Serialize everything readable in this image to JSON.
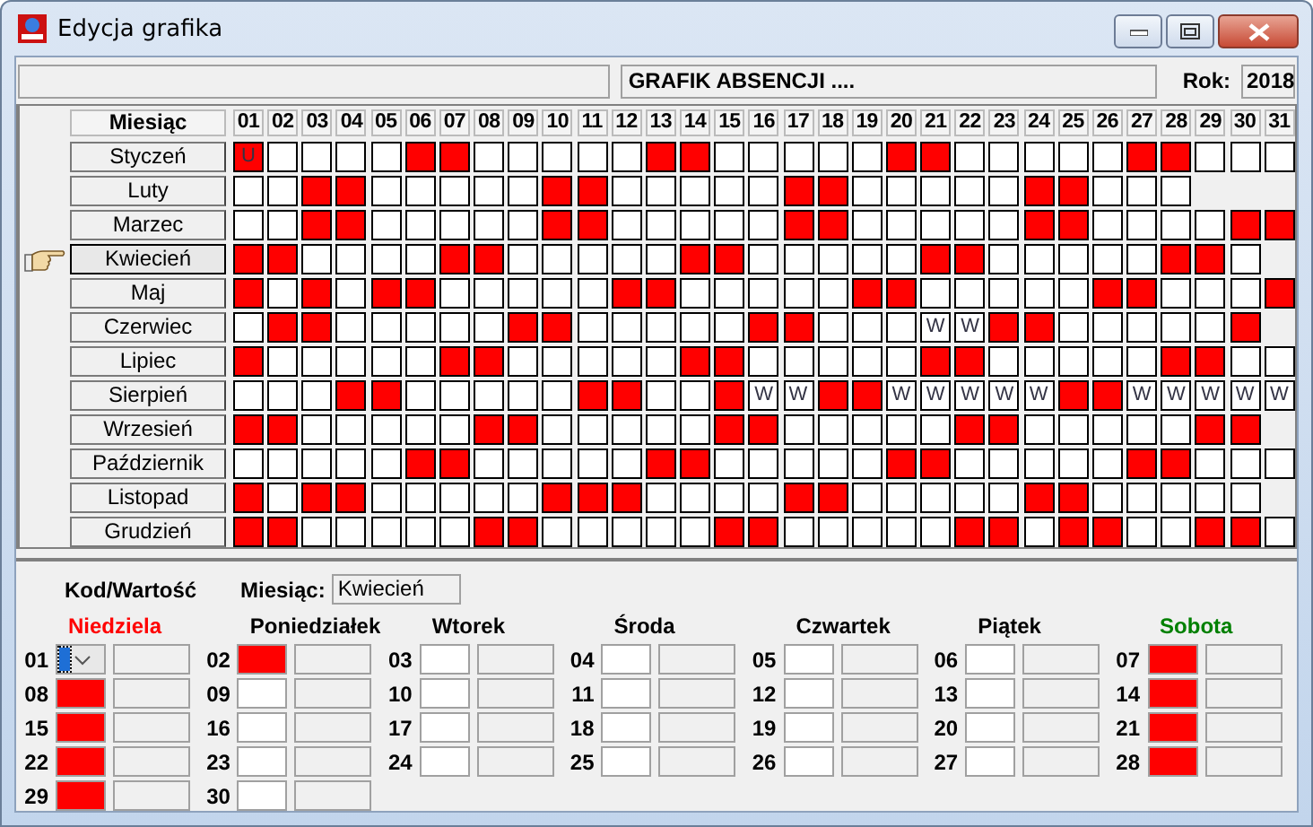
{
  "window": {
    "title": "Edycja grafika"
  },
  "header": {
    "schedule_title": "GRAFIK ABSENCJI ....",
    "year_label": "Rok:",
    "year": "2018"
  },
  "grid": {
    "month_heading": "Miesiąc",
    "day_headers": [
      "01",
      "02",
      "03",
      "04",
      "05",
      "06",
      "07",
      "08",
      "09",
      "10",
      "11",
      "12",
      "13",
      "14",
      "15",
      "16",
      "17",
      "18",
      "19",
      "20",
      "21",
      "22",
      "23",
      "24",
      "25",
      "26",
      "27",
      "28",
      "29",
      "30",
      "31"
    ],
    "months": [
      {
        "name": "Styczeń",
        "selected": false,
        "cells": [
          {
            "marked": true,
            "text": "U"
          },
          {
            "marked": false
          },
          {
            "marked": false
          },
          {
            "marked": false
          },
          {
            "marked": false
          },
          {
            "marked": true
          },
          {
            "marked": true
          },
          {
            "marked": false
          },
          {
            "marked": false
          },
          {
            "marked": false
          },
          {
            "marked": false
          },
          {
            "marked": false
          },
          {
            "marked": true
          },
          {
            "marked": true
          },
          {
            "marked": false
          },
          {
            "marked": false
          },
          {
            "marked": false
          },
          {
            "marked": false
          },
          {
            "marked": false
          },
          {
            "marked": true
          },
          {
            "marked": true
          },
          {
            "marked": false
          },
          {
            "marked": false
          },
          {
            "marked": false
          },
          {
            "marked": false
          },
          {
            "marked": false
          },
          {
            "marked": true
          },
          {
            "marked": true
          },
          {
            "marked": false
          },
          {
            "marked": false
          },
          {
            "marked": false
          }
        ]
      },
      {
        "name": "Luty",
        "selected": false,
        "cells": [
          {
            "marked": false
          },
          {
            "marked": false
          },
          {
            "marked": true
          },
          {
            "marked": true
          },
          {
            "marked": false
          },
          {
            "marked": false
          },
          {
            "marked": false
          },
          {
            "marked": false
          },
          {
            "marked": false
          },
          {
            "marked": true
          },
          {
            "marked": true
          },
          {
            "marked": false
          },
          {
            "marked": false
          },
          {
            "marked": false
          },
          {
            "marked": false
          },
          {
            "marked": false
          },
          {
            "marked": true
          },
          {
            "marked": true
          },
          {
            "marked": false
          },
          {
            "marked": false
          },
          {
            "marked": false
          },
          {
            "marked": false
          },
          {
            "marked": false
          },
          {
            "marked": true
          },
          {
            "marked": true
          },
          {
            "marked": false
          },
          {
            "marked": false
          },
          {
            "marked": false
          }
        ]
      },
      {
        "name": "Marzec",
        "selected": false,
        "cells": [
          {
            "marked": false
          },
          {
            "marked": false
          },
          {
            "marked": true
          },
          {
            "marked": true
          },
          {
            "marked": false
          },
          {
            "marked": false
          },
          {
            "marked": false
          },
          {
            "marked": false
          },
          {
            "marked": false
          },
          {
            "marked": true
          },
          {
            "marked": true
          },
          {
            "marked": false
          },
          {
            "marked": false
          },
          {
            "marked": false
          },
          {
            "marked": false
          },
          {
            "marked": false
          },
          {
            "marked": true
          },
          {
            "marked": true
          },
          {
            "marked": false
          },
          {
            "marked": false
          },
          {
            "marked": false
          },
          {
            "marked": false
          },
          {
            "marked": false
          },
          {
            "marked": true
          },
          {
            "marked": true
          },
          {
            "marked": false
          },
          {
            "marked": false
          },
          {
            "marked": false
          },
          {
            "marked": false
          },
          {
            "marked": true
          },
          {
            "marked": true
          }
        ]
      },
      {
        "name": "Kwiecień",
        "selected": true,
        "cells": [
          {
            "marked": true
          },
          {
            "marked": true
          },
          {
            "marked": false
          },
          {
            "marked": false
          },
          {
            "marked": false
          },
          {
            "marked": false
          },
          {
            "marked": true
          },
          {
            "marked": true
          },
          {
            "marked": false
          },
          {
            "marked": false
          },
          {
            "marked": false
          },
          {
            "marked": false
          },
          {
            "marked": false
          },
          {
            "marked": true
          },
          {
            "marked": true
          },
          {
            "marked": false
          },
          {
            "marked": false
          },
          {
            "marked": false
          },
          {
            "marked": false
          },
          {
            "marked": false
          },
          {
            "marked": true
          },
          {
            "marked": true
          },
          {
            "marked": false
          },
          {
            "marked": false
          },
          {
            "marked": false
          },
          {
            "marked": false
          },
          {
            "marked": false
          },
          {
            "marked": true
          },
          {
            "marked": true
          },
          {
            "marked": false
          }
        ]
      },
      {
        "name": "Maj",
        "selected": false,
        "cells": [
          {
            "marked": true
          },
          {
            "marked": false
          },
          {
            "marked": true
          },
          {
            "marked": false
          },
          {
            "marked": true
          },
          {
            "marked": true
          },
          {
            "marked": false
          },
          {
            "marked": false
          },
          {
            "marked": false
          },
          {
            "marked": false
          },
          {
            "marked": false
          },
          {
            "marked": true
          },
          {
            "marked": true
          },
          {
            "marked": false
          },
          {
            "marked": false
          },
          {
            "marked": false
          },
          {
            "marked": false
          },
          {
            "marked": false
          },
          {
            "marked": true
          },
          {
            "marked": true
          },
          {
            "marked": false
          },
          {
            "marked": false
          },
          {
            "marked": false
          },
          {
            "marked": false
          },
          {
            "marked": false
          },
          {
            "marked": true
          },
          {
            "marked": true
          },
          {
            "marked": false
          },
          {
            "marked": false
          },
          {
            "marked": false
          },
          {
            "marked": true
          }
        ]
      },
      {
        "name": "Czerwiec",
        "selected": false,
        "cells": [
          {
            "marked": false
          },
          {
            "marked": true
          },
          {
            "marked": true
          },
          {
            "marked": false
          },
          {
            "marked": false
          },
          {
            "marked": false
          },
          {
            "marked": false
          },
          {
            "marked": false
          },
          {
            "marked": true
          },
          {
            "marked": true
          },
          {
            "marked": false
          },
          {
            "marked": false
          },
          {
            "marked": false
          },
          {
            "marked": false
          },
          {
            "marked": false
          },
          {
            "marked": true
          },
          {
            "marked": true
          },
          {
            "marked": false
          },
          {
            "marked": false
          },
          {
            "marked": false
          },
          {
            "marked": false,
            "text": "W"
          },
          {
            "marked": false,
            "text": "W"
          },
          {
            "marked": true
          },
          {
            "marked": true
          },
          {
            "marked": false
          },
          {
            "marked": false
          },
          {
            "marked": false
          },
          {
            "marked": false
          },
          {
            "marked": false
          },
          {
            "marked": true
          }
        ]
      },
      {
        "name": "Lipiec",
        "selected": false,
        "cells": [
          {
            "marked": true
          },
          {
            "marked": false
          },
          {
            "marked": false
          },
          {
            "marked": false
          },
          {
            "marked": false
          },
          {
            "marked": false
          },
          {
            "marked": true
          },
          {
            "marked": true
          },
          {
            "marked": false
          },
          {
            "marked": false
          },
          {
            "marked": false
          },
          {
            "marked": false
          },
          {
            "marked": false
          },
          {
            "marked": true
          },
          {
            "marked": true
          },
          {
            "marked": false
          },
          {
            "marked": false
          },
          {
            "marked": false
          },
          {
            "marked": false
          },
          {
            "marked": false
          },
          {
            "marked": true
          },
          {
            "marked": true
          },
          {
            "marked": false
          },
          {
            "marked": false
          },
          {
            "marked": false
          },
          {
            "marked": false
          },
          {
            "marked": false
          },
          {
            "marked": true
          },
          {
            "marked": true
          },
          {
            "marked": false
          },
          {
            "marked": false
          }
        ]
      },
      {
        "name": "Sierpień",
        "selected": false,
        "cells": [
          {
            "marked": false
          },
          {
            "marked": false
          },
          {
            "marked": false
          },
          {
            "marked": true
          },
          {
            "marked": true
          },
          {
            "marked": false
          },
          {
            "marked": false
          },
          {
            "marked": false
          },
          {
            "marked": false
          },
          {
            "marked": false
          },
          {
            "marked": true
          },
          {
            "marked": true
          },
          {
            "marked": false
          },
          {
            "marked": false
          },
          {
            "marked": true
          },
          {
            "marked": false,
            "text": "W"
          },
          {
            "marked": false,
            "text": "W"
          },
          {
            "marked": true
          },
          {
            "marked": true
          },
          {
            "marked": false,
            "text": "W"
          },
          {
            "marked": false,
            "text": "W"
          },
          {
            "marked": false,
            "text": "W"
          },
          {
            "marked": false,
            "text": "W"
          },
          {
            "marked": false,
            "text": "W"
          },
          {
            "marked": true
          },
          {
            "marked": true
          },
          {
            "marked": false,
            "text": "W"
          },
          {
            "marked": false,
            "text": "W"
          },
          {
            "marked": false,
            "text": "W"
          },
          {
            "marked": false,
            "text": "W"
          },
          {
            "marked": false,
            "text": "W"
          }
        ]
      },
      {
        "name": "Wrzesień",
        "selected": false,
        "cells": [
          {
            "marked": true
          },
          {
            "marked": true
          },
          {
            "marked": false
          },
          {
            "marked": false
          },
          {
            "marked": false
          },
          {
            "marked": false
          },
          {
            "marked": false
          },
          {
            "marked": true
          },
          {
            "marked": true
          },
          {
            "marked": false
          },
          {
            "marked": false
          },
          {
            "marked": false
          },
          {
            "marked": false
          },
          {
            "marked": false
          },
          {
            "marked": true
          },
          {
            "marked": true
          },
          {
            "marked": false
          },
          {
            "marked": false
          },
          {
            "marked": false
          },
          {
            "marked": false
          },
          {
            "marked": false
          },
          {
            "marked": true
          },
          {
            "marked": true
          },
          {
            "marked": false
          },
          {
            "marked": false
          },
          {
            "marked": false
          },
          {
            "marked": false
          },
          {
            "marked": false
          },
          {
            "marked": true
          },
          {
            "marked": true
          }
        ]
      },
      {
        "name": "Październik",
        "selected": false,
        "cells": [
          {
            "marked": false
          },
          {
            "marked": false
          },
          {
            "marked": false
          },
          {
            "marked": false
          },
          {
            "marked": false
          },
          {
            "marked": true
          },
          {
            "marked": true
          },
          {
            "marked": false
          },
          {
            "marked": false
          },
          {
            "marked": false
          },
          {
            "marked": false
          },
          {
            "marked": false
          },
          {
            "marked": true
          },
          {
            "marked": true
          },
          {
            "marked": false
          },
          {
            "marked": false
          },
          {
            "marked": false
          },
          {
            "marked": false
          },
          {
            "marked": false
          },
          {
            "marked": true
          },
          {
            "marked": true
          },
          {
            "marked": false
          },
          {
            "marked": false
          },
          {
            "marked": false
          },
          {
            "marked": false
          },
          {
            "marked": false
          },
          {
            "marked": true
          },
          {
            "marked": true
          },
          {
            "marked": false
          },
          {
            "marked": false
          },
          {
            "marked": false
          }
        ]
      },
      {
        "name": "Listopad",
        "selected": false,
        "cells": [
          {
            "marked": true
          },
          {
            "marked": false
          },
          {
            "marked": true
          },
          {
            "marked": true
          },
          {
            "marked": false
          },
          {
            "marked": false
          },
          {
            "marked": false
          },
          {
            "marked": false
          },
          {
            "marked": false
          },
          {
            "marked": true
          },
          {
            "marked": true
          },
          {
            "marked": true
          },
          {
            "marked": false
          },
          {
            "marked": false
          },
          {
            "marked": false
          },
          {
            "marked": false
          },
          {
            "marked": true
          },
          {
            "marked": true
          },
          {
            "marked": false
          },
          {
            "marked": false
          },
          {
            "marked": false
          },
          {
            "marked": false
          },
          {
            "marked": false
          },
          {
            "marked": true
          },
          {
            "marked": true
          },
          {
            "marked": false
          },
          {
            "marked": false
          },
          {
            "marked": false
          },
          {
            "marked": false
          },
          {
            "marked": false
          }
        ]
      },
      {
        "name": "Grudzień",
        "selected": false,
        "cells": [
          {
            "marked": true
          },
          {
            "marked": true
          },
          {
            "marked": false
          },
          {
            "marked": false
          },
          {
            "marked": false
          },
          {
            "marked": false
          },
          {
            "marked": false
          },
          {
            "marked": true
          },
          {
            "marked": true
          },
          {
            "marked": false
          },
          {
            "marked": false
          },
          {
            "marked": false
          },
          {
            "marked": false
          },
          {
            "marked": false
          },
          {
            "marked": true
          },
          {
            "marked": true
          },
          {
            "marked": false
          },
          {
            "marked": false
          },
          {
            "marked": false
          },
          {
            "marked": false
          },
          {
            "marked": false
          },
          {
            "marked": true
          },
          {
            "marked": true
          },
          {
            "marked": false
          },
          {
            "marked": true
          },
          {
            "marked": true
          },
          {
            "marked": false
          },
          {
            "marked": false
          },
          {
            "marked": true
          },
          {
            "marked": true
          },
          {
            "marked": false
          }
        ]
      }
    ]
  },
  "detail": {
    "code_label": "Kod/Wartość",
    "month_label": "Miesiąc:",
    "month_value": "Kwiecień",
    "weekdays": [
      {
        "name": "Niedziela",
        "color": "#ff0000",
        "days": [
          {
            "day": "01",
            "kind": "dropdown",
            "marked": false
          },
          {
            "day": "08",
            "kind": "box",
            "marked": true
          },
          {
            "day": "15",
            "kind": "box",
            "marked": true
          },
          {
            "day": "22",
            "kind": "box",
            "marked": true
          },
          {
            "day": "29",
            "kind": "box",
            "marked": true
          }
        ]
      },
      {
        "name": "Poniedziałek",
        "color": "#000000",
        "days": [
          {
            "day": "02",
            "kind": "box",
            "marked": true
          },
          {
            "day": "09",
            "kind": "box",
            "marked": false
          },
          {
            "day": "16",
            "kind": "box",
            "marked": false
          },
          {
            "day": "23",
            "kind": "box",
            "marked": false
          },
          {
            "day": "30",
            "kind": "box",
            "marked": false
          }
        ]
      },
      {
        "name": "Wtorek",
        "color": "#000000",
        "days": [
          {
            "day": "03",
            "kind": "box",
            "marked": false
          },
          {
            "day": "10",
            "kind": "box",
            "marked": false
          },
          {
            "day": "17",
            "kind": "box",
            "marked": false
          },
          {
            "day": "24",
            "kind": "box",
            "marked": false
          }
        ]
      },
      {
        "name": "Środa",
        "color": "#000000",
        "days": [
          {
            "day": "04",
            "kind": "box",
            "marked": false
          },
          {
            "day": "11",
            "kind": "box",
            "marked": false
          },
          {
            "day": "18",
            "kind": "box",
            "marked": false
          },
          {
            "day": "25",
            "kind": "box",
            "marked": false
          }
        ]
      },
      {
        "name": "Czwartek",
        "color": "#000000",
        "days": [
          {
            "day": "05",
            "kind": "box",
            "marked": false
          },
          {
            "day": "12",
            "kind": "box",
            "marked": false
          },
          {
            "day": "19",
            "kind": "box",
            "marked": false
          },
          {
            "day": "26",
            "kind": "box",
            "marked": false
          }
        ]
      },
      {
        "name": "Piątek",
        "color": "#000000",
        "days": [
          {
            "day": "06",
            "kind": "box",
            "marked": false
          },
          {
            "day": "13",
            "kind": "box",
            "marked": false
          },
          {
            "day": "20",
            "kind": "box",
            "marked": false
          },
          {
            "day": "27",
            "kind": "box",
            "marked": false
          }
        ]
      },
      {
        "name": "Sobota",
        "color": "#008000",
        "days": [
          {
            "day": "07",
            "kind": "box",
            "marked": true
          },
          {
            "day": "14",
            "kind": "box",
            "marked": true
          },
          {
            "day": "21",
            "kind": "box",
            "marked": true
          },
          {
            "day": "28",
            "kind": "box",
            "marked": true
          }
        ]
      }
    ]
  }
}
